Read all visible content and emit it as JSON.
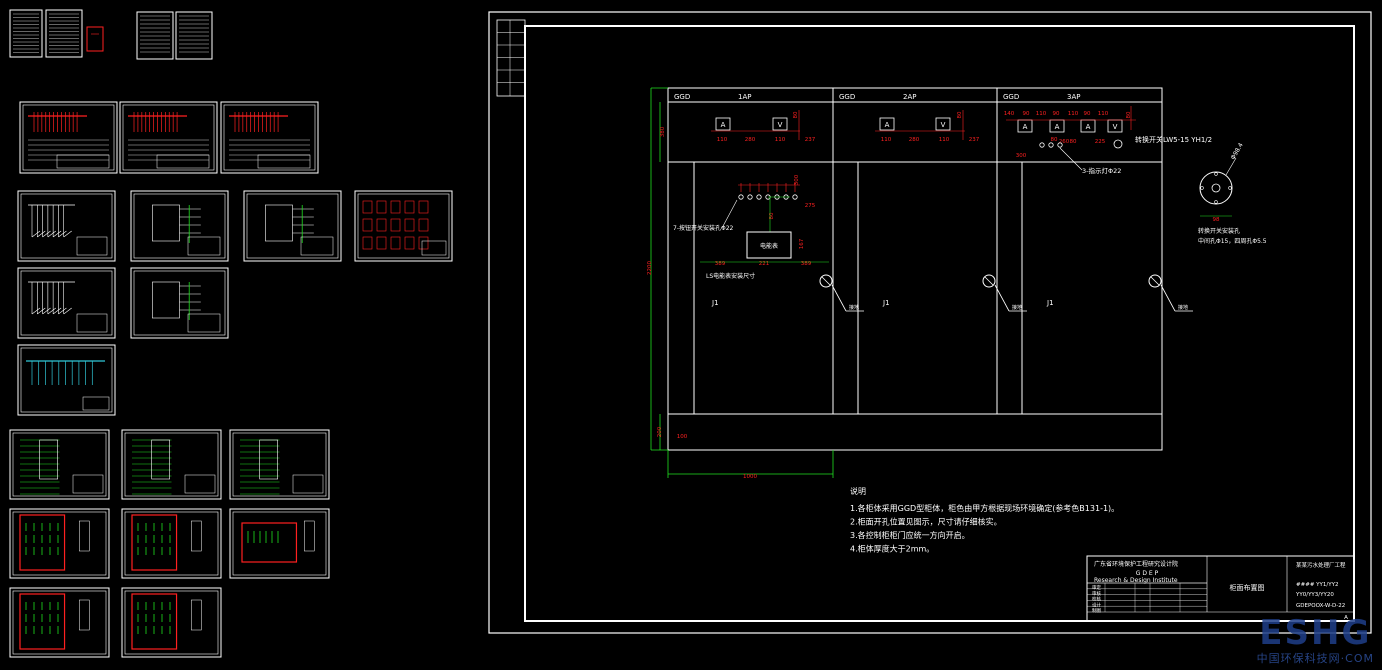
{
  "sheet": {
    "sections": [
      {
        "type": "GGD",
        "name": "1AP",
        "ground_label": "J1"
      },
      {
        "type": "GGD",
        "name": "2AP",
        "ground_label": "J1"
      },
      {
        "type": "GGD",
        "name": "3AP",
        "ground_label": "J1"
      }
    ],
    "meter_labels": [
      "A",
      "V"
    ],
    "dims": {
      "row_top_height": "380",
      "total_height": "2200",
      "bottom_height": "200",
      "base_offset": "100",
      "width": "1000",
      "sec1": [
        "110",
        "280",
        "110",
        "237"
      ],
      "sec2": [
        "110",
        "280",
        "110",
        "237"
      ],
      "sec3": [
        "140",
        "90",
        "110",
        "90",
        "110",
        "90",
        "110"
      ],
      "sec3_lower": [
        "300",
        "80",
        "80",
        "225"
      ],
      "vert_small": [
        "80",
        "80"
      ],
      "mid": [
        "300",
        "80",
        "275",
        "260",
        "167",
        "389",
        "221",
        "389"
      ],
      "circle_d": "Φ98.4",
      "circle_w": "98"
    },
    "callouts": {
      "c1": "7-按钮开关安装孔Φ22",
      "c2": "3-指示灯Φ22",
      "c3": "转换开关LW5-15 YH1/2",
      "box": "电能表",
      "under": "LS电能表安装尺寸",
      "knob_note_1": "转换开关安装孔",
      "knob_note_2": "中间孔Φ15，四周孔Φ5.5",
      "ground": "接地"
    },
    "notes": {
      "title": "说明",
      "items": [
        "1.各柜体采用GGD型柜体，柜色由甲方根据现场环境确定(参考色B131-1)。",
        "2.柜面开孔位置见图示，尺寸请仔细核实。",
        "3.各控制柜柜门应统一方向开启。",
        "4.柜体厚度大于2mm。"
      ]
    },
    "title_block": {
      "org_cn": "广东省环境保护工程研究设计院",
      "org_abbr": "G D E P",
      "org_en": "Research & Design Institute",
      "drawing_name": "柜面布置图",
      "project": "某某污水处理厂工程",
      "code1": "#### YY1/YY2",
      "code2": "YY0/YY3/YY20",
      "drawing_no": "GDEPOOX-W-D-22",
      "sheet_letter": "A",
      "rows": [
        "审定",
        "审核",
        "校核",
        "设计",
        "制图"
      ]
    }
  },
  "watermark": {
    "logo": "ESHG",
    "text": "中国环保科技网·COM"
  },
  "colors": {
    "white": "#ffffff",
    "red": "#ff2020",
    "green": "#20e020",
    "cyan": "#30c8d8",
    "yellow": "#e8e830",
    "bg": "#000000"
  }
}
